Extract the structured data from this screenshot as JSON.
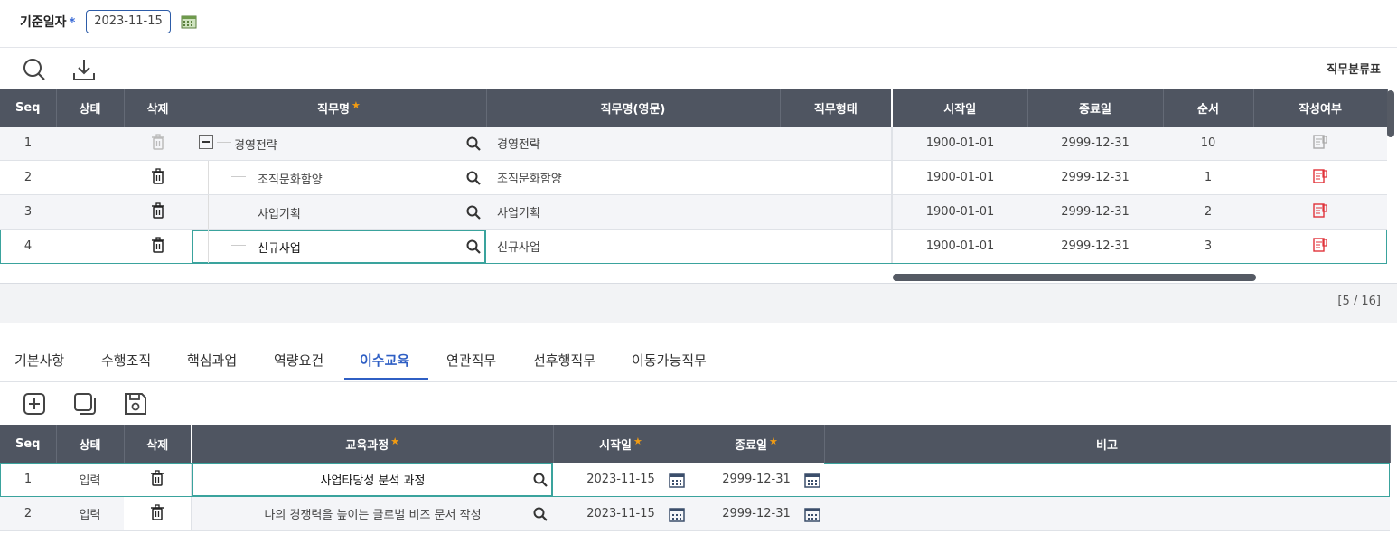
{
  "header": {
    "date_label": "기준일자",
    "required_mark": "*",
    "date_value": "2023-11-15"
  },
  "toolbar": {
    "title_right": "직무분류표",
    "icons": [
      "search-icon",
      "download-icon"
    ]
  },
  "job_grid": {
    "columns": [
      "Seq",
      "상태",
      "삭제",
      "직무명",
      "직무명(영문)",
      "직무형태",
      "시작일",
      "종료일",
      "순서",
      "작성여부"
    ],
    "rows": [
      {
        "seq": "1",
        "status": "",
        "name": "경영전략",
        "name_en": "경영전략",
        "type": "",
        "start": "1900-01-01",
        "end": "2999-12-31",
        "order": "10"
      },
      {
        "seq": "2",
        "status": "",
        "name": "조직문화함양",
        "name_en": "조직문화함양",
        "type": "",
        "start": "1900-01-01",
        "end": "2999-12-31",
        "order": "1"
      },
      {
        "seq": "3",
        "status": "",
        "name": "사업기획",
        "name_en": "사업기획",
        "type": "",
        "start": "1900-01-01",
        "end": "2999-12-31",
        "order": "2"
      },
      {
        "seq": "4",
        "status": "",
        "name": "신규사업",
        "name_en": "신규사업",
        "type": "",
        "start": "1900-01-01",
        "end": "2999-12-31",
        "order": "3"
      }
    ],
    "count": "[5 / 16]"
  },
  "tabs": [
    "기본사항",
    "수행조직",
    "핵심과업",
    "역량요건",
    "이수교육",
    "연관직무",
    "선후행직무",
    "이동가능직무"
  ],
  "active_tab": "이수교육",
  "edu_grid": {
    "columns": [
      "Seq",
      "상태",
      "삭제",
      "교육과정",
      "시작일",
      "종료일",
      "비고"
    ],
    "rows": [
      {
        "seq": "1",
        "status": "입력",
        "course": "사업타당성 분석 과정",
        "start": "2023-11-15",
        "end": "2999-12-31",
        "note": ""
      },
      {
        "seq": "2",
        "status": "입력",
        "course": "나의 경쟁력을 높이는 글로벌 비즈 문서 작성",
        "start": "2023-11-15",
        "end": "2999-12-31",
        "note": ""
      }
    ]
  },
  "colors": {
    "header_bg": "#4f5561",
    "accent": "#2f5fc4",
    "selection": "#3aa39d",
    "write_icon": "#e0323a"
  }
}
